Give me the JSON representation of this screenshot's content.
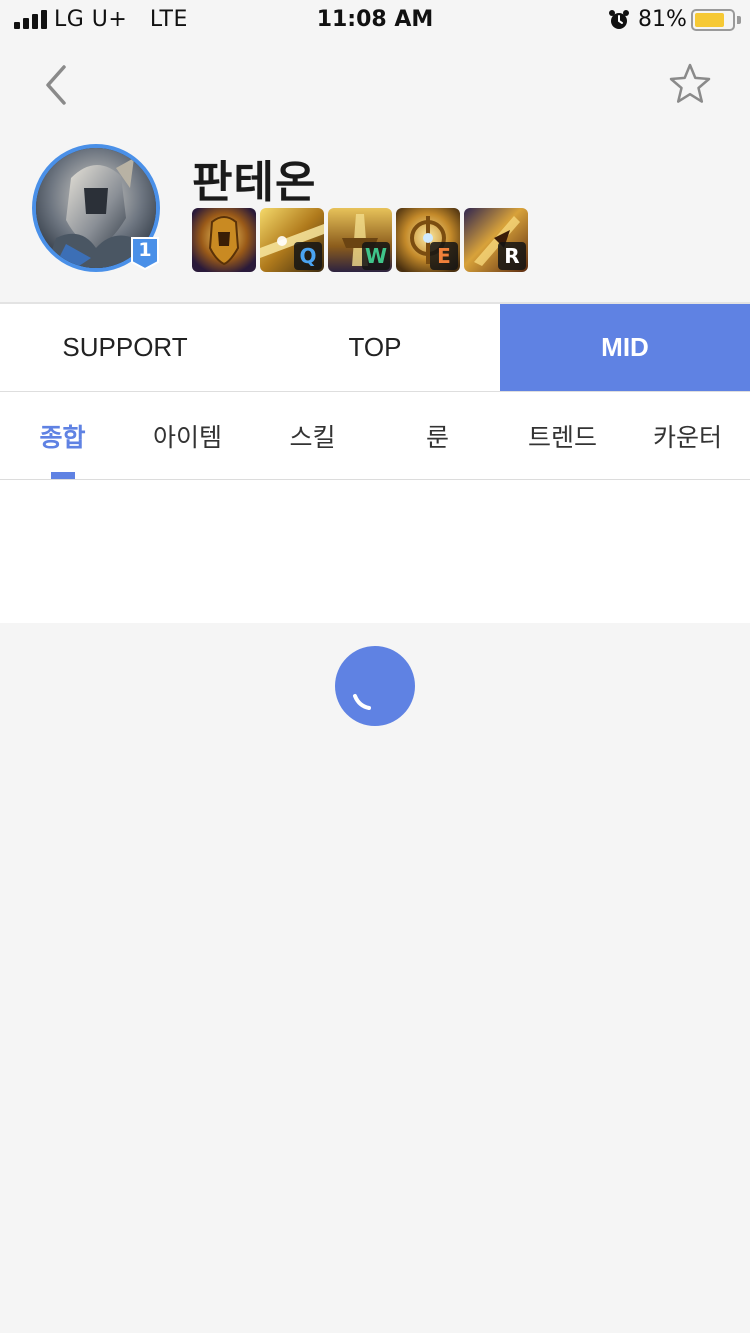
{
  "status_bar": {
    "carrier": "LG U+",
    "network": "LTE",
    "time": "11:08 AM",
    "battery_percent_text": "81%",
    "battery_level": 0.81,
    "icons": [
      "signal-bars-icon",
      "alarm-clock-icon",
      "battery-icon"
    ]
  },
  "nav": {
    "back_icon": "chevron-left-icon",
    "favorite_icon": "star-outline-icon"
  },
  "champion": {
    "name": "판테온",
    "rank_badge": "1",
    "skills": [
      {
        "key": "",
        "key_color": "#ffffff"
      },
      {
        "key": "Q",
        "key_color": "#4aa3f0"
      },
      {
        "key": "W",
        "key_color": "#3fc48a"
      },
      {
        "key": "E",
        "key_color": "#f0803a"
      },
      {
        "key": "R",
        "key_color": "#ffffff"
      }
    ]
  },
  "position_tabs": [
    {
      "label": "SUPPORT",
      "active": false
    },
    {
      "label": "TOP",
      "active": false
    },
    {
      "label": "MID",
      "active": true
    }
  ],
  "sub_tabs": [
    {
      "label": "종합",
      "active": true
    },
    {
      "label": "아이템",
      "active": false
    },
    {
      "label": "스킬",
      "active": false
    },
    {
      "label": "룬",
      "active": false
    },
    {
      "label": "트렌드",
      "active": false
    },
    {
      "label": "카운터",
      "active": false
    }
  ],
  "colors": {
    "accent": "#5f82e3",
    "avatar_ring": "#4a90e8",
    "battery": "#f6c935"
  },
  "loading_indicator": "spinner-icon"
}
